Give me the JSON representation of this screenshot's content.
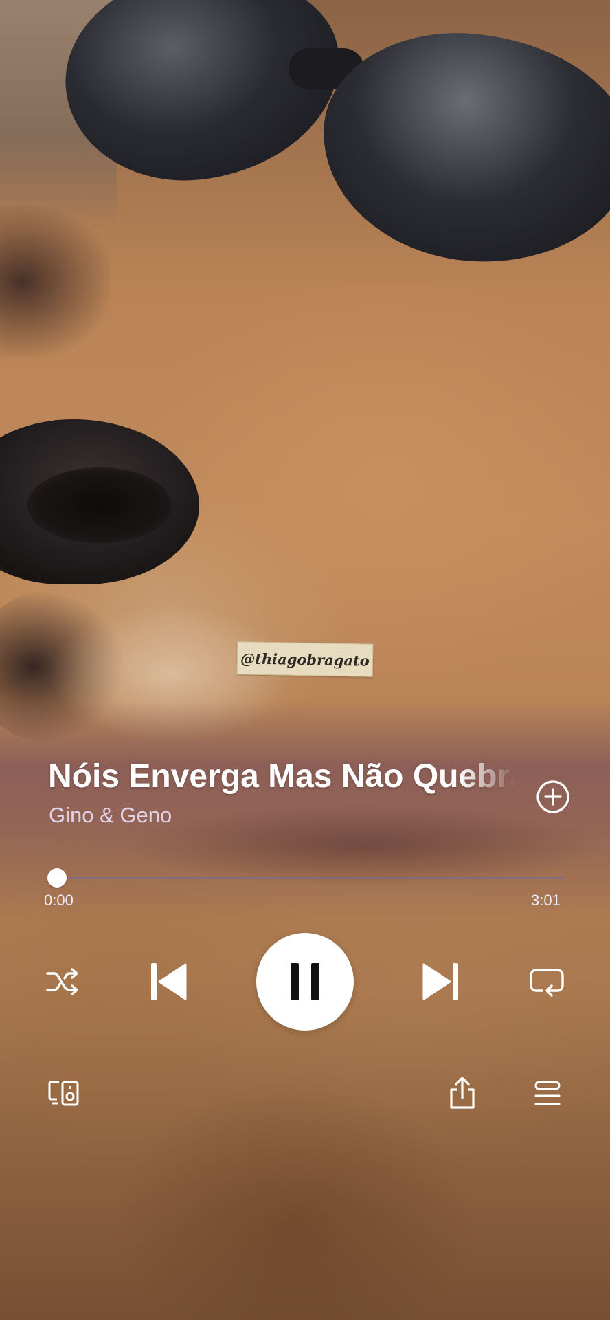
{
  "watermark": {
    "text": "@thiagobragato"
  },
  "track": {
    "title": "Nóis Enverga Mas Não Quebra",
    "artist": "Gino & Geno"
  },
  "playback": {
    "progress_fraction": 0.012,
    "current_time": "0:00",
    "total_time": "3:01",
    "is_playing": true
  },
  "icons": {
    "add": "plus-circle-icon",
    "shuffle": "shuffle-icon",
    "previous": "skip-previous-icon",
    "pause": "pause-icon",
    "next": "skip-next-icon",
    "repeat": "repeat-icon",
    "devices": "connect-devices-icon",
    "share": "share-icon",
    "queue": "queue-icon"
  },
  "colors": {
    "progress_track": "#7864aa",
    "artist_text": "#e8dcf7",
    "accent_tint": "#3c1e5a"
  }
}
